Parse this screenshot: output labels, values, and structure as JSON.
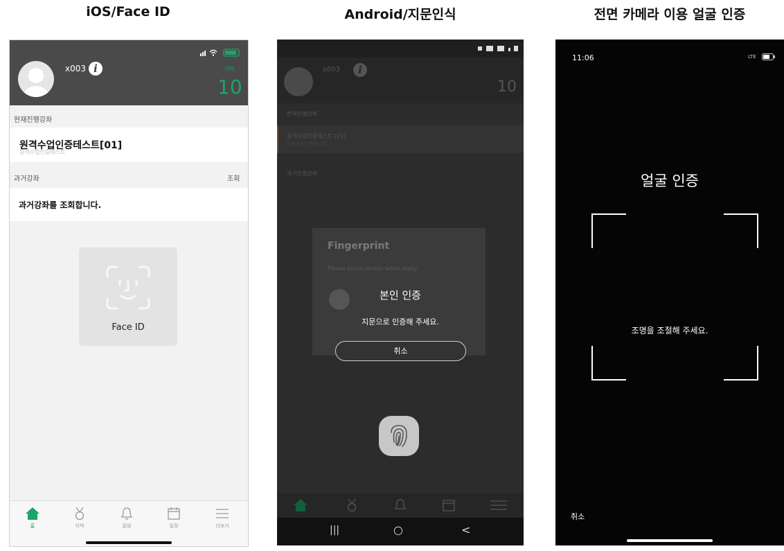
{
  "columns": {
    "ios_title": "iOS/Face ID",
    "android_title": "Android/지문인식",
    "camera_title": "전면 카메라 이용 얼굴 인증"
  },
  "ios": {
    "username": "x003",
    "count_label": "기타",
    "count_value": "10",
    "current_section": "현재진행강좌",
    "current_course": "원격수업인증테스트[01]",
    "current_course_sub": "원격수업인증테스트",
    "past_section": "과거강좌",
    "past_action": "조회",
    "past_message": "과거강좌를 조회합니다.",
    "face_id_label": "Face ID",
    "nav": [
      "홈",
      "이력",
      "알림",
      "일정",
      "더보기"
    ],
    "accent": "#1aa56b"
  },
  "android": {
    "bg_username": "x003",
    "bg_count": "10",
    "bg_current_section": "현재진행강좌",
    "bg_course": "원격수업인증테스트 [01]",
    "bg_course_sub": "원격수업인증테스트",
    "bg_past_section": "과거진행강좌",
    "fingerprint_title": "Fingerprint",
    "fingerprint_hint": "Please touch sensor when ready",
    "auth_title": "본인 인증",
    "auth_message": "지문으로 인증해 주세요.",
    "cancel_label": "취소",
    "nav": [
      "홈",
      "이력",
      "알림",
      "일정",
      "더보기"
    ],
    "sysnav": [
      "|||",
      "○",
      "<"
    ]
  },
  "camera": {
    "time": "11:06",
    "network": "LTE",
    "title": "얼굴 인증",
    "message": "조명을 조절해 주세요.",
    "cancel_label": "취소"
  }
}
